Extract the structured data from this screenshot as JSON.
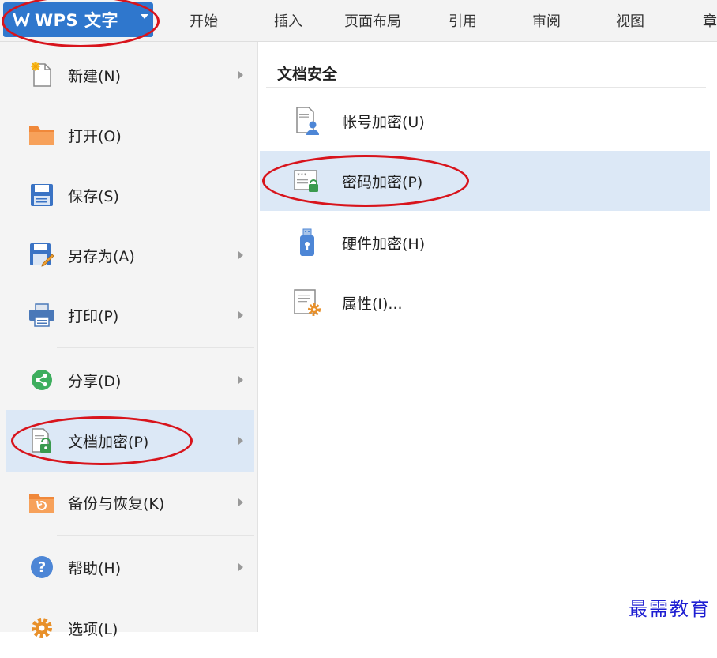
{
  "app": {
    "title": "WPS 文字"
  },
  "tabs": [
    "开始",
    "插入",
    "页面布局",
    "引用",
    "审阅",
    "视图",
    "章"
  ],
  "left_menu": [
    {
      "label": "新建(N)",
      "icon": "new-doc-icon",
      "has_submenu": true,
      "selected": false
    },
    {
      "label": "打开(O)",
      "icon": "folder-open-icon",
      "has_submenu": false,
      "selected": false
    },
    {
      "label": "保存(S)",
      "icon": "save-icon",
      "has_submenu": false,
      "selected": false
    },
    {
      "label": "另存为(A)",
      "icon": "save-as-icon",
      "has_submenu": true,
      "selected": false
    },
    {
      "label": "打印(P)",
      "icon": "print-icon",
      "has_submenu": true,
      "selected": false
    },
    {
      "label": "分享(D)",
      "icon": "share-icon",
      "has_submenu": true,
      "selected": false
    },
    {
      "label": "文档加密(P)",
      "icon": "doc-encrypt-icon",
      "has_submenu": true,
      "selected": true
    },
    {
      "label": "备份与恢复(K)",
      "icon": "backup-restore-icon",
      "has_submenu": true,
      "selected": false
    },
    {
      "label": "帮助(H)",
      "icon": "help-icon",
      "has_submenu": true,
      "selected": false
    },
    {
      "label": "选项(L)",
      "icon": "gear-icon",
      "has_submenu": false,
      "selected": false
    }
  ],
  "submenu": {
    "header": "文档安全",
    "items": [
      {
        "label": "帐号加密(U)",
        "icon": "account-encrypt-icon",
        "selected": false
      },
      {
        "label": "密码加密(P)",
        "icon": "password-encrypt-icon",
        "selected": true
      },
      {
        "label": "硬件加密(H)",
        "icon": "hardware-encrypt-icon",
        "selected": false
      },
      {
        "label": "属性(I)...",
        "icon": "properties-icon",
        "selected": false
      }
    ]
  },
  "colors": {
    "accent": "#2f77cd",
    "selection": "#dce8f6",
    "annotation": "#d8141c",
    "watermark": "#1e1ed2"
  },
  "watermark": "最需教育"
}
